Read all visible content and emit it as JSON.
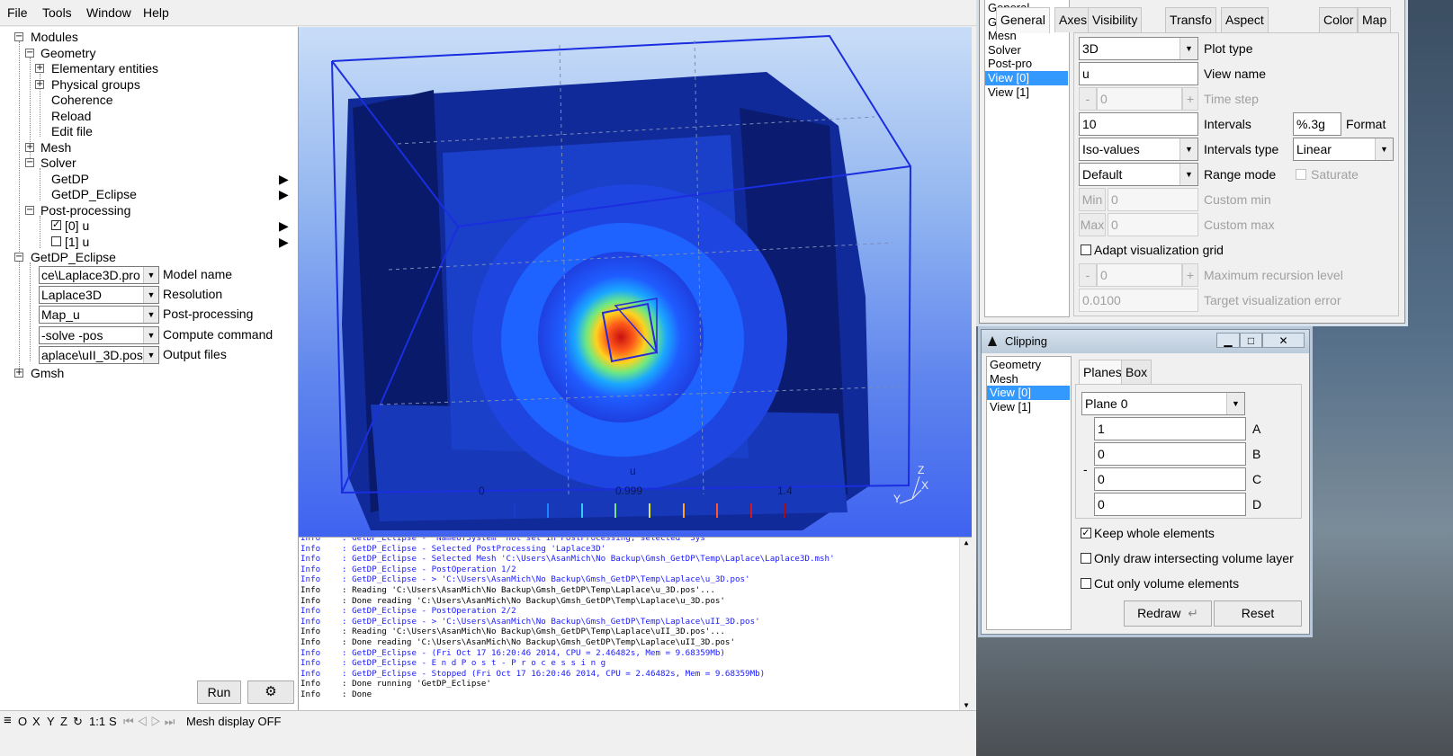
{
  "menu": [
    "File",
    "Tools",
    "Window",
    "Help"
  ],
  "tree": {
    "modules": "Modules",
    "geometry": "Geometry",
    "elementary": "Elementary entities",
    "physical": "Physical groups",
    "coherence": "Coherence",
    "reload": "Reload",
    "edit_file": "Edit file",
    "mesh": "Mesh",
    "solver": "Solver",
    "getdp": "GetDP",
    "getdp_eclipse": "GetDP_Eclipse",
    "postprocessing": "Post-processing",
    "view0": "[0] u",
    "view1": "[1] u",
    "getdp_eclipse_root": "GetDP_Eclipse",
    "gmsh": "Gmsh",
    "params": [
      {
        "value": "ce\\Laplace3D.pro",
        "label": "Model name"
      },
      {
        "value": "Laplace3D",
        "label": "Resolution"
      },
      {
        "value": "Map_u",
        "label": "Post-processing"
      },
      {
        "value": "-solve -pos",
        "label": "Compute command"
      },
      {
        "value": "aplace\\uII_3D.pos",
        "label": "Output files"
      }
    ]
  },
  "buttons": {
    "run": "Run",
    "gear": "⚙"
  },
  "viewport": {
    "scale_title": "u",
    "scale_min": "0",
    "scale_mid": "0.999",
    "scale_max": "1.4",
    "axis_z": "Z",
    "axis_y": "Y",
    "axis_x": "X"
  },
  "log": [
    {
      "level": "Info",
      "msg": ": GetDP_Eclipse - 'NameOfSystem' not set in PostProcessing, selected 'Sys'",
      "color": "#1a1aff"
    },
    {
      "level": "Info",
      "msg": ": GetDP_Eclipse - Selected PostProcessing 'Laplace3D'",
      "color": "#1a1aff"
    },
    {
      "level": "Info",
      "msg": ": GetDP_Eclipse - Selected Mesh 'C:\\Users\\AsanMich\\No Backup\\Gmsh_GetDP\\Temp\\Laplace\\Laplace3D.msh'",
      "color": "#1a1aff"
    },
    {
      "level": "Info",
      "msg": ": GetDP_Eclipse - PostOperation 1/2",
      "color": "#1a1aff"
    },
    {
      "level": "Info",
      "msg": ": GetDP_Eclipse -            > 'C:\\Users\\AsanMich\\No Backup\\Gmsh_GetDP\\Temp\\Laplace\\u_3D.pos'",
      "color": "#1a1aff"
    },
    {
      "level": "Info",
      "msg": ": Reading 'C:\\Users\\AsanMich\\No Backup\\Gmsh_GetDP\\Temp\\Laplace\\u_3D.pos'...",
      "color": "#000000"
    },
    {
      "level": "Info",
      "msg": ": Done reading 'C:\\Users\\AsanMich\\No Backup\\Gmsh_GetDP\\Temp\\Laplace\\u_3D.pos'",
      "color": "#000000"
    },
    {
      "level": "Info",
      "msg": ": GetDP_Eclipse - PostOperation 2/2",
      "color": "#1a1aff"
    },
    {
      "level": "Info",
      "msg": ": GetDP_Eclipse -            > 'C:\\Users\\AsanMich\\No Backup\\Gmsh_GetDP\\Temp\\Laplace\\uII_3D.pos'",
      "color": "#1a1aff"
    },
    {
      "level": "Info",
      "msg": ": Reading 'C:\\Users\\AsanMich\\No Backup\\Gmsh_GetDP\\Temp\\Laplace\\uII_3D.pos'...",
      "color": "#000000"
    },
    {
      "level": "Info",
      "msg": ": Done reading 'C:\\Users\\AsanMich\\No Backup\\Gmsh_GetDP\\Temp\\Laplace\\uII_3D.pos'",
      "color": "#000000"
    },
    {
      "level": "Info",
      "msg": ": GetDP_Eclipse - (Fri Oct 17 16:20:46 2014, CPU = 2.46482s, Mem = 9.68359Mb)",
      "color": "#1a1aff"
    },
    {
      "level": "Info",
      "msg": ": GetDP_Eclipse - E n d   P o s t - P r o c e s s i n g",
      "color": "#1a1aff"
    },
    {
      "level": "Info",
      "msg": ": GetDP_Eclipse - Stopped (Fri Oct 17 16:20:46 2014, CPU = 2.46482s, Mem = 9.68359Mb)",
      "color": "#1a1aff"
    },
    {
      "level": "Info",
      "msg": ": Done running 'GetDP_Eclipse'",
      "color": "#000000"
    },
    {
      "level": "Info",
      "msg": ": Done",
      "color": "#000000"
    }
  ],
  "statusbar": {
    "menu_icon": "≡",
    "o": "O",
    "x": "X",
    "y": "Y",
    "z": "Z",
    "rotate_icon": "↻",
    "scale": "1:1",
    "s": "S",
    "nav_icons": "⏮ ◁ ▷ ⏭",
    "message": "Mesh display OFF"
  },
  "options": {
    "categories": [
      "General",
      "Geometry",
      "Mesh",
      "Solver",
      "Post-pro",
      "View [0]",
      "View [1]"
    ],
    "selected_category": "View [0]",
    "tabs": [
      "General",
      "Axes",
      "Visibility",
      "Transfo",
      "Aspect",
      "Color",
      "Map"
    ],
    "plot_type": "3D",
    "plot_type_label": "Plot type",
    "view_name": "u",
    "view_name_label": "View name",
    "time_minus": "-",
    "time_step": "0",
    "time_plus": "+",
    "time_step_label": "Time step",
    "intervals": "10",
    "intervals_label": "Intervals",
    "format": "%.3g",
    "format_label": "Format",
    "intervals_type": "Iso-values",
    "intervals_type_label": "Intervals type",
    "scale_type": "Linear",
    "range_mode": "Default",
    "range_mode_label": "Range mode",
    "saturate_label": "Saturate",
    "min_btn": "Min",
    "min_val": "0",
    "custom_min_label": "Custom min",
    "max_btn": "Max",
    "max_val": "0",
    "custom_max_label": "Custom max",
    "adapt_label": "Adapt visualization grid",
    "recursion_minus": "-",
    "recursion_val": "0",
    "recursion_plus": "+",
    "recursion_label": "Maximum recursion level",
    "target_val": "0.0100",
    "target_label": "Target visualization error"
  },
  "clipping": {
    "title": "Clipping",
    "categories": [
      "Geometry",
      "Mesh",
      "View [0]",
      "View [1]"
    ],
    "selected_category": "View [0]",
    "tabs": [
      "Planes",
      "Box"
    ],
    "plane": "Plane 0",
    "coef_a": "1",
    "label_a": "A",
    "coef_b": "0",
    "label_b": "B",
    "coef_c": "0",
    "label_c": "C",
    "coef_d": "0",
    "label_d": "D",
    "dash": "-",
    "keep_whole": "Keep whole elements",
    "only_intersecting": "Only draw intersecting volume layer",
    "cut_only": "Cut only volume elements",
    "redraw": "Redraw",
    "redraw_icon": "↵",
    "reset": "Reset",
    "win_min": "▁",
    "win_max": "□",
    "win_close": "✕"
  }
}
